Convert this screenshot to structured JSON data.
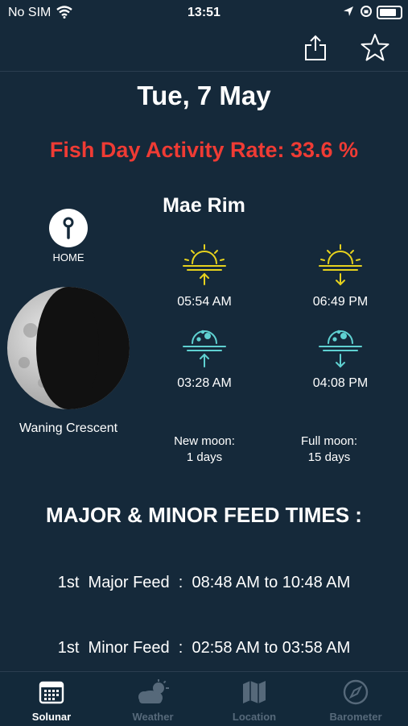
{
  "status_bar": {
    "carrier": "No SIM",
    "time": "13:51"
  },
  "header": {
    "date": "Tue, 7 May",
    "activity_rate": "Fish Day Activity Rate: 33.6 %",
    "location_name": "Mae Rim"
  },
  "home": {
    "label": "HOME"
  },
  "moon": {
    "phase": "Waning Crescent",
    "icon": "waning-crescent-moon"
  },
  "sun": {
    "rise": "05:54 AM",
    "set": "06:49 PM"
  },
  "moon_times": {
    "rise": "03:28 AM",
    "set": "04:08 PM"
  },
  "moon_cycle": {
    "new_label": "New moon:",
    "new_value": "1 days",
    "full_label": "Full moon:",
    "full_value": "15 days"
  },
  "feed": {
    "title": "MAJOR & MINOR FEED TIMES :",
    "rows": [
      {
        "text": "1st  Major Feed  :  08:48 AM to 10:48 AM"
      },
      {
        "text": "1st  Minor Feed  :  02:58 AM to 03:58 AM"
      }
    ]
  },
  "tabs": [
    {
      "label": "Solunar",
      "icon": "calendar-icon",
      "active": true
    },
    {
      "label": "Weather",
      "icon": "weather-icon",
      "active": false
    },
    {
      "label": "Location",
      "icon": "map-icon",
      "active": false
    },
    {
      "label": "Barometer",
      "icon": "compass-icon",
      "active": false
    }
  ],
  "colors": {
    "background": "#15293a",
    "accent_red": "#ef3b34",
    "sun_yellow": "#e6d21e",
    "moon_teal": "#5fd1d1",
    "tab_inactive": "#56697a"
  }
}
